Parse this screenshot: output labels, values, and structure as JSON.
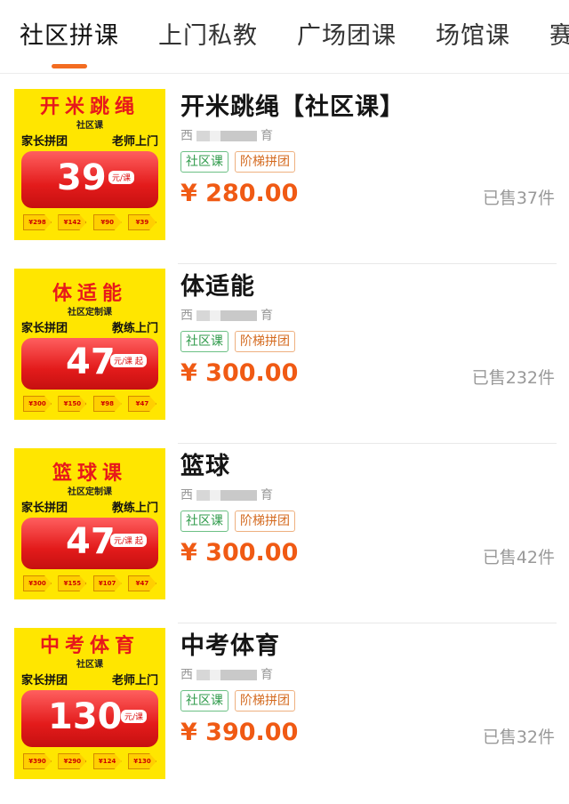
{
  "tabs": [
    {
      "label": "社区拼课",
      "active": true
    },
    {
      "label": "上门私教",
      "active": false
    },
    {
      "label": "广场团课",
      "active": false
    },
    {
      "label": "场馆课",
      "active": false
    },
    {
      "label": "赛",
      "active": false
    }
  ],
  "accent_color": "#f36c21",
  "price_color": "#f05a14",
  "products": [
    {
      "thumb_title": "开米跳绳",
      "thumb_sub": "社区课",
      "thumb_tag_left": "家长拼团",
      "thumb_tag_right": "老师上门",
      "thumb_price": "39",
      "thumb_unit": "元/课",
      "thumb_steps": [
        "¥298",
        "¥142",
        "¥90",
        "¥39"
      ],
      "title": "开米跳绳【社区课】",
      "shop_start": "西",
      "shop_end": "育",
      "tags": [
        "社区课",
        "阶梯拼团"
      ],
      "price": "¥ 280.00",
      "sold": "已售37件"
    },
    {
      "thumb_title": "体适能",
      "thumb_sub": "社区定制课",
      "thumb_tag_left": "家长拼团",
      "thumb_tag_right": "教练上门",
      "thumb_price": "47",
      "thumb_unit": "元/课 起",
      "thumb_steps": [
        "¥300",
        "¥150",
        "¥98",
        "¥47"
      ],
      "title": "体适能",
      "shop_start": "西",
      "shop_end": "育",
      "tags": [
        "社区课",
        "阶梯拼团"
      ],
      "price": "¥ 300.00",
      "sold": "已售232件"
    },
    {
      "thumb_title": "篮球课",
      "thumb_sub": "社区定制课",
      "thumb_tag_left": "家长拼团",
      "thumb_tag_right": "教练上门",
      "thumb_price": "47",
      "thumb_unit": "元/课 起",
      "thumb_steps": [
        "¥300",
        "¥155",
        "¥107",
        "¥47"
      ],
      "title": "篮球",
      "shop_start": "西",
      "shop_end": "育",
      "tags": [
        "社区课",
        "阶梯拼团"
      ],
      "price": "¥ 300.00",
      "sold": "已售42件"
    },
    {
      "thumb_title": "中考体育",
      "thumb_sub": "社区课",
      "thumb_tag_left": "家长拼团",
      "thumb_tag_right": "老师上门",
      "thumb_price": "130",
      "thumb_unit": "元/课",
      "thumb_steps": [
        "¥390",
        "¥290",
        "¥124",
        "¥130"
      ],
      "title": "中考体育",
      "shop_start": "西",
      "shop_end": "育",
      "tags": [
        "社区课",
        "阶梯拼团"
      ],
      "price": "¥ 390.00",
      "sold": "已售32件"
    }
  ]
}
